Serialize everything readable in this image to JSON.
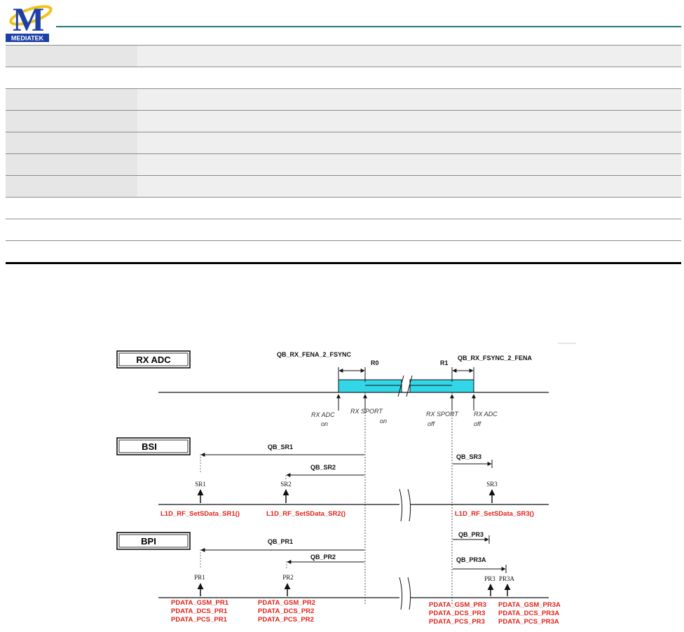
{
  "header": {
    "logo_text": "MEDIATEK",
    "logo_colors": {
      "letter": "#1d3fa8",
      "ring": "#f2c21a",
      "rule": "#1f7a73"
    }
  },
  "form_table": {
    "row_count": 9
  },
  "diagram": {
    "rx_adc": {
      "title": "RX ADC",
      "qb_fena": "QB_RX_FENA_2_FSYNC",
      "qb_fsync": "QB_RX_FSYNC_2_FENA",
      "r0": "R0",
      "r1": "R1",
      "adc_on": [
        "RX ADC",
        "on"
      ],
      "sport_on": [
        "RX SPORT",
        "on"
      ],
      "sport_off": [
        "RX SPORT",
        "off"
      ],
      "adc_off": [
        "RX ADC",
        "off"
      ],
      "bar_color": "#33d6e6"
    },
    "bsi": {
      "title": "BSI",
      "qb_sr1": "QB_SR1",
      "qb_sr2": "QB_SR2",
      "qb_sr3": "QB_SR3",
      "sr1": "SR1",
      "sr2": "SR2",
      "sr3": "SR3",
      "fn_sr1": "L1D_RF_SetSData_SR1()",
      "fn_sr2": "L1D_RF_SetSData_SR2()",
      "fn_sr3": "L1D_RF_SetSData_SR3()"
    },
    "bpi": {
      "title": "BPI",
      "qb_pr1": "QB_PR1",
      "qb_pr2": "QB_PR2",
      "qb_pr3": "QB_PR3",
      "qb_pr3a": "QB_PR3A",
      "pr1": "PR1",
      "pr2": "PR2",
      "pr3": "PR3",
      "pr3a": "PR3A",
      "pr1_data": [
        "PDATA_GSM_PR1",
        "PDATA_DCS_PR1",
        "PDATA_PCS_PR1"
      ],
      "pr2_data": [
        "PDATA_GSM_PR2",
        "PDATA_DCS_PR2",
        "PDATA_PCS_PR2"
      ],
      "pr3_data": [
        "PDATA_GSM_PR3",
        "PDATA_DCS_PR3",
        "PDATA_PCS_PR3"
      ],
      "pr3a_data": [
        "PDATA_GSM_PR3A",
        "PDATA_DCS_PR3A",
        "PDATA_PCS_PR3A"
      ],
      "label_color": "#e0231c"
    }
  }
}
